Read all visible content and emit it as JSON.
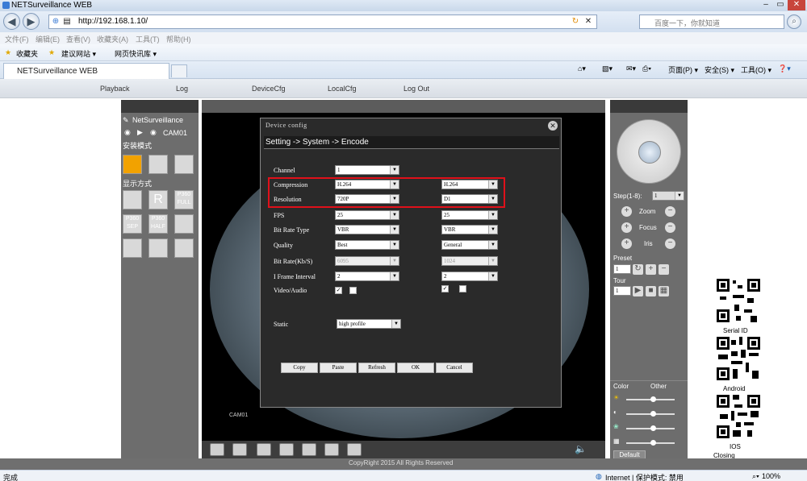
{
  "browser": {
    "title": "NETSurveillance WEB",
    "url": "http://192.168.1.10/",
    "search_placeholder": "百度一下，你就知道",
    "menu": [
      "文件(F)",
      "编辑(E)",
      "查看(V)",
      "收藏夹(A)",
      "工具(T)",
      "帮助(H)"
    ],
    "favorites": {
      "label": "收藏夹",
      "items": [
        "建议网站 ▾",
        "网页快讯库 ▾"
      ]
    },
    "tab_title": "NETSurveillance WEB",
    "toolbar_right": [
      "页面(P) ▾",
      "安全(S) ▾",
      "工具(O) ▾"
    ],
    "status": {
      "left": "完成",
      "zone": "Internet | 保护模式: 禁用",
      "zoom": "100%"
    }
  },
  "nav": [
    "Playback",
    "Log",
    "DeviceCfg",
    "LocalCfg",
    "Log Out"
  ],
  "left_panel": {
    "brand": "NetSurveillance",
    "camera": "CAM01",
    "install_mode": "安装模式",
    "display_mode": "显示方式",
    "buttons": [
      "R",
      "P360\nFULL",
      "P360\nSEP",
      "P360\nHALF"
    ]
  },
  "video": {
    "cam_label": "CAM01"
  },
  "dialog": {
    "title": "Device config",
    "breadcrumb": "Setting -> System -> Encode",
    "rows": [
      {
        "label": "Channel",
        "main": "1",
        "sub": ""
      },
      {
        "label": "Compression",
        "main": "H.264",
        "sub": "H.264"
      },
      {
        "label": "Resolution",
        "main": "720P",
        "sub": "D1"
      },
      {
        "label": "FPS",
        "main": "25",
        "sub": "25"
      },
      {
        "label": "Bit Rate Type",
        "main": "VBR",
        "sub": "VBR"
      },
      {
        "label": "Quality",
        "main": "Best",
        "sub": "General"
      },
      {
        "label": "Bit Rate(Kb/S)",
        "main": "6095",
        "sub": "1024"
      },
      {
        "label": "I Frame Interval",
        "main": "2",
        "sub": "2"
      },
      {
        "label": "Video/Audio",
        "main": "",
        "sub": ""
      }
    ],
    "static_label": "Static",
    "static_value": "high profile",
    "buttons": [
      "Copy",
      "Paste",
      "Refresh",
      "OK",
      "Cancel"
    ]
  },
  "ptz": {
    "step_label": "Step(1-8):",
    "step_value": "1",
    "zoom": "Zoom",
    "focus": "Focus",
    "iris": "Iris",
    "preset": "Preset",
    "preset_value": "1",
    "tour": "Tour",
    "tour_value": "1",
    "color_tab": "Color",
    "other_tab": "Other",
    "default_button": "Default"
  },
  "qr": {
    "serial": "Serial ID",
    "android": "Android",
    "ios": "IOS",
    "closing": "Closing"
  },
  "footer": "CopyRight 2015 All Rights Reserved"
}
